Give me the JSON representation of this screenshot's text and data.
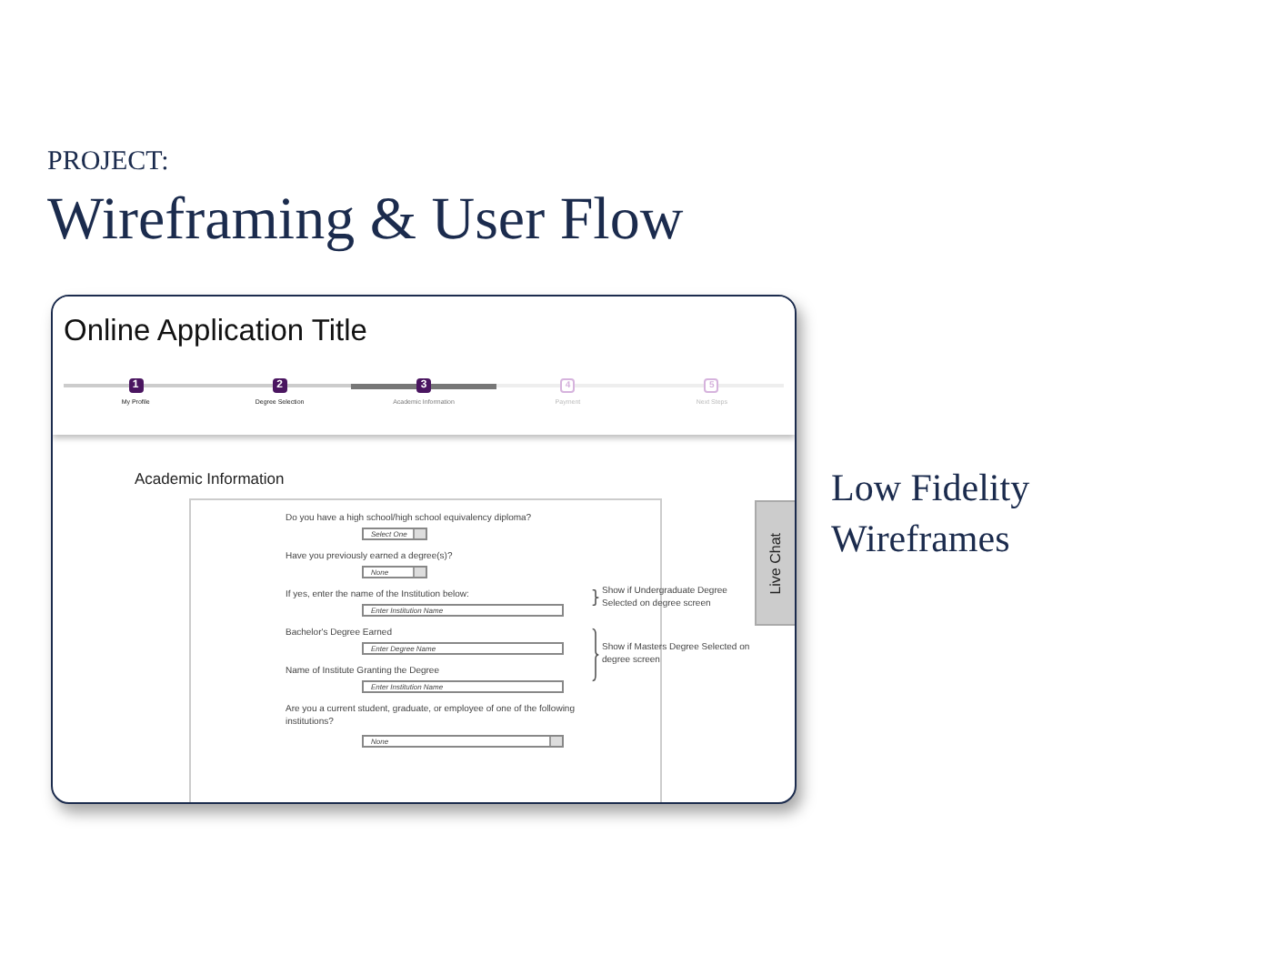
{
  "page": {
    "eyebrow": "PROJECT:",
    "title": "Wireframing & User Flow",
    "caption": "Low Fidelity Wireframes"
  },
  "wireframe": {
    "title": "Online Application Title",
    "steps": [
      {
        "number": "1",
        "label": "My Profile",
        "completed": true,
        "selected": false
      },
      {
        "number": "2",
        "label": "Degree Selection",
        "completed": true,
        "selected": false
      },
      {
        "number": "3",
        "label": "Academic Information",
        "completed": false,
        "selected": true
      },
      {
        "number": "4",
        "label": "Payment",
        "completed": false,
        "selected": false
      },
      {
        "number": "5",
        "label": "Next Steps",
        "completed": false,
        "selected": false
      }
    ],
    "section_title": "Academic Information",
    "groups": [
      {
        "questions": [
          {
            "kind": "select",
            "label": "Do you have a high school/high school equivalency diploma?",
            "value": "Select One",
            "wide": false
          }
        ]
      },
      {
        "questions": [
          {
            "kind": "select",
            "label": "Have you previously earned a degree(s)?",
            "value": "None",
            "wide": false
          }
        ]
      },
      {
        "note": "Show if Undergraduate Degree Selected on degree screen",
        "questions": [
          {
            "kind": "text",
            "label": "If yes, enter the name of the Institution below:",
            "placeholder": "Enter Institution Name"
          }
        ]
      },
      {
        "note": "Show if Masters Degree Selected on degree screen",
        "questions": [
          {
            "kind": "text",
            "label": "Bachelor's Degree Earned",
            "placeholder": "Enter Degree Name"
          },
          {
            "kind": "text",
            "label": "Name of Institute Granting the Degree",
            "placeholder": "Enter Institution Name"
          }
        ]
      },
      {
        "questions": [
          {
            "kind": "select",
            "label": "Are you a current student, graduate, or employee of one of the following institutions?",
            "value": "None",
            "wide": true
          }
        ]
      }
    ],
    "live_chat": "Live Chat"
  }
}
